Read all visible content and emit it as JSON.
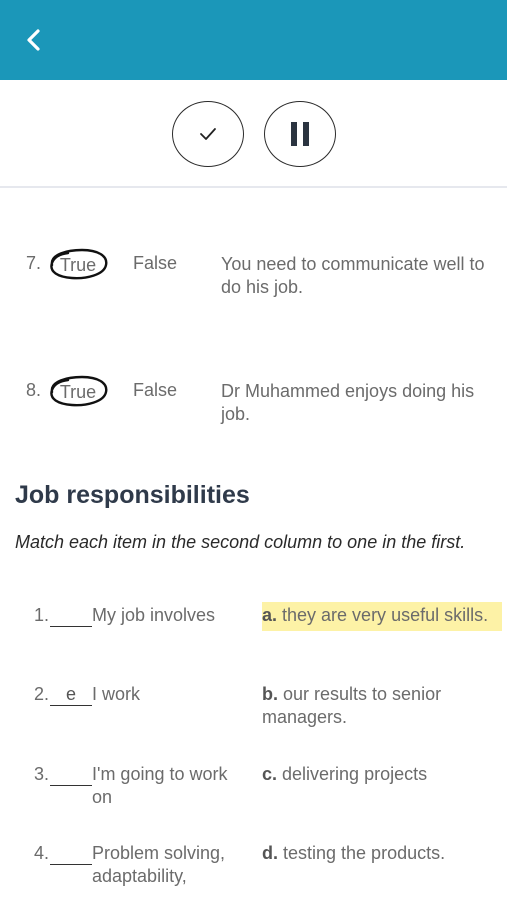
{
  "header": {
    "back_icon": "chevron-left-icon",
    "color": "#1b97b9"
  },
  "controls": {
    "check_icon": "check-icon",
    "pause_icon": "pause-icon"
  },
  "true_false": [
    {
      "number": "7.",
      "true_label": "True",
      "false_label": "False",
      "circled": "True",
      "statement": "You need to communicate well to do his job."
    },
    {
      "number": "8.",
      "true_label": "True",
      "false_label": "False",
      "circled": "True",
      "statement": "Dr Muhammed enjoys doing his job."
    }
  ],
  "section": {
    "title": "Job responsibilities",
    "instructions": "Match each item in the second column to one in the first."
  },
  "matching": [
    {
      "number": "1.",
      "answer": "",
      "left": "My job involves",
      "letter": "a.",
      "right": " they are very useful skills.",
      "highlighted": true
    },
    {
      "number": "2.",
      "answer": "e",
      "left": "I work",
      "letter": "b.",
      "right": " our results to senior managers.",
      "highlighted": false
    },
    {
      "number": "3.",
      "answer": "",
      "left": "I'm going to work on",
      "letter": "c.",
      "right": " delivering projects",
      "highlighted": false
    },
    {
      "number": "4.",
      "answer": "",
      "left": "Problem solving, adaptability,",
      "letter": "d.",
      "right": " testing the products.",
      "highlighted": false
    }
  ]
}
